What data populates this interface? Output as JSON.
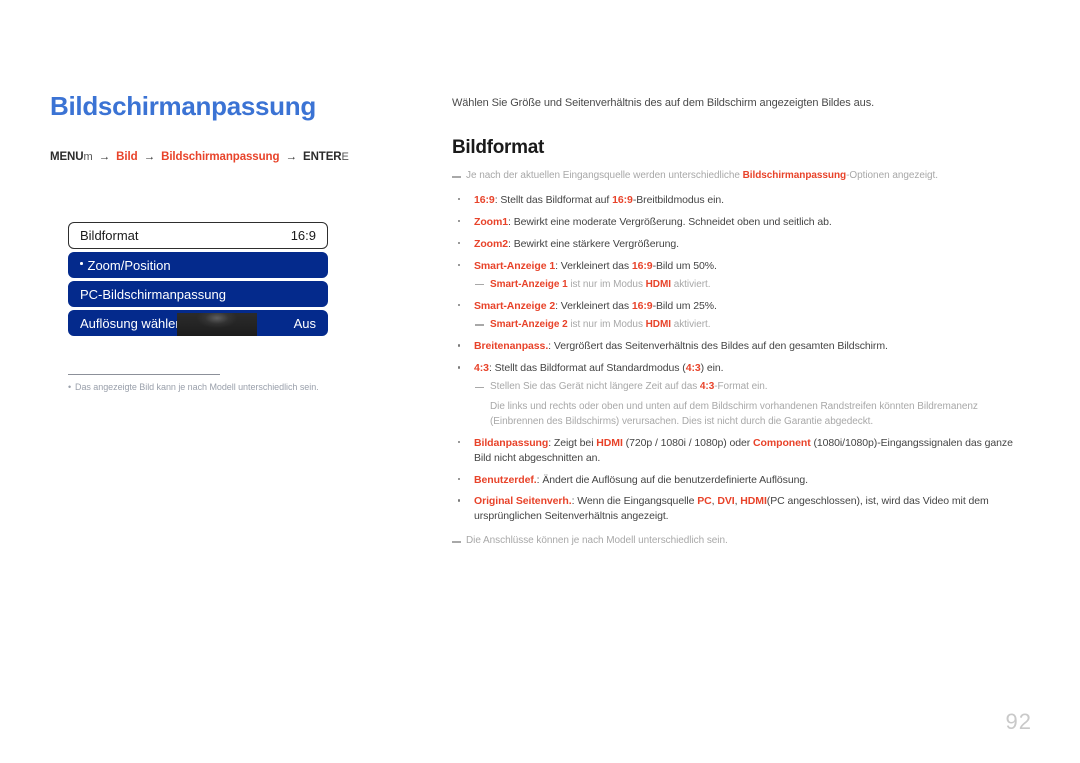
{
  "page": {
    "title": "Bildschirmanpassung",
    "number": "92"
  },
  "breadcrumb": {
    "menu_label": "MENU",
    "menu_key": "m",
    "arrow": "→",
    "item1": "Bild",
    "item2": "Bildschirmanpassung",
    "enter_label": "ENTER",
    "enter_key": "E"
  },
  "menu_mock": {
    "rows": [
      {
        "label": "Bildformat",
        "value": "16:9",
        "style": "value-row"
      },
      {
        "label": "Zoom/Position",
        "value": "",
        "style": "blue-row",
        "dot": true
      },
      {
        "label": "PC-Bildschirmanpassung",
        "value": "",
        "style": "blue-row"
      },
      {
        "label": "Auflösung wählen",
        "value": "Aus",
        "style": "blue-row",
        "overlay": true
      }
    ],
    "footnote_bullet": "•",
    "footnote": "Das angezeigte Bild kann je nach Modell unterschiedlich sein."
  },
  "content": {
    "intro": "Wählen Sie Größe und Seitenverhältnis des auf dem Bildschirm angezeigten Bildes aus.",
    "section_title": "Bildformat",
    "top_note": {
      "before": "Je nach der aktuellen Eingangsquelle werden unterschiedliche ",
      "accent": "Bildschirmanpassung",
      "after": "-Optionen angezeigt."
    },
    "options": [
      {
        "name": "16:9",
        "text_before": ": Stellt das Bildformat auf ",
        "inline_accent": "16:9",
        "text_after": "-Breitbildmodus ein."
      },
      {
        "name": "Zoom1",
        "text_before": ": Bewirkt eine moderate Vergrößerung. Schneidet oben und seitlich ab.",
        "inline_accent": "",
        "text_after": ""
      },
      {
        "name": "Zoom2",
        "text_before": ": Bewirkt eine stärkere Vergrößerung.",
        "inline_accent": "",
        "text_after": ""
      },
      {
        "name": "Smart-Anzeige 1",
        "text_before": ": Verkleinert das ",
        "inline_accent": "16:9",
        "text_after": "-Bild um 50%.",
        "note": {
          "accent": "Smart-Anzeige 1",
          "mid": " ist nur im Modus ",
          "accent2": "HDMI",
          "end": " aktiviert."
        }
      },
      {
        "name": "Smart-Anzeige 2",
        "text_before": ": Verkleinert das ",
        "inline_accent": "16:9",
        "text_after": "-Bild um 25%.",
        "note": {
          "accent": "Smart-Anzeige 2",
          "mid": " ist nur im Modus ",
          "accent2": "HDMI",
          "end": " aktiviert."
        }
      },
      {
        "name": "Breitenanpass.",
        "text_before": ": Vergrößert das Seitenverhältnis des Bildes auf den gesamten Bildschirm.",
        "inline_accent": "",
        "text_after": ""
      },
      {
        "name": "4:3",
        "text_before": ": Stellt das Bildformat auf Standardmodus (",
        "inline_accent": "4:3",
        "text_after": ") ein.",
        "note_plain_before": "Stellen Sie das Gerät nicht längere Zeit auf das ",
        "note_plain_accent": "4:3",
        "note_plain_after": "-Format ein.",
        "warning": "Die links und rechts oder oben und unten auf dem Bildschirm vorhandenen Randstreifen könnten Bildremanenz (Einbrennen des Bildschirms) verursachen. Dies ist nicht durch die Garantie abgedeckt."
      },
      {
        "name": "Bildanpassung",
        "text_before": ": Zeigt bei ",
        "inline_accent": "HDMI",
        "text_mid": " (720p / 1080i / 1080p) oder ",
        "inline_accent2": "Component",
        "text_after": " (1080i/1080p)-Eingangssignalen das ganze Bild nicht abgeschnitten an."
      },
      {
        "name": "Benutzerdef.",
        "text_before": ": Ändert die Auflösung auf die benutzerdefinierte Auflösung.",
        "inline_accent": "",
        "text_after": ""
      },
      {
        "name": "Original Seitenverh.",
        "text_before": ": Wenn die Eingangsquelle ",
        "inline_accent": "PC",
        "sep1": ", ",
        "inline_accent2": "DVI",
        "sep2": ", ",
        "inline_accent3": "HDMI",
        "text_after": "(PC angeschlossen), ist, wird das Video mit dem ursprünglichen Seitenverhältnis angezeigt."
      }
    ],
    "bottom_note": "Die Anschlüsse können je nach Modell unterschiedlich sein."
  },
  "colors": {
    "title_blue": "#3b73d4",
    "menu_blue": "#042a8c",
    "accent_red": "#e8432a",
    "muted_gray": "#a8a8a8"
  }
}
